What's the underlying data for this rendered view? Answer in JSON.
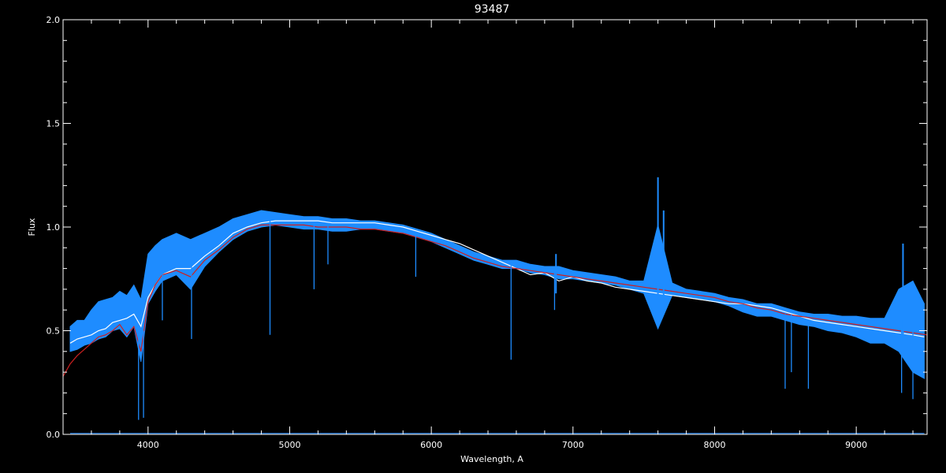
{
  "chart_data": {
    "type": "line",
    "title": "93487",
    "xlabel": "Wavelength, A",
    "ylabel": "Flux",
    "xlim": [
      3400,
      9500
    ],
    "ylim": [
      0.0,
      2.0
    ],
    "xticks": [
      "4000",
      "5000",
      "6000",
      "7000",
      "8000",
      "9000"
    ],
    "yticks": [
      "0.0",
      "0.5",
      "1.0",
      "1.5",
      "2.0"
    ],
    "grid": false,
    "background": "#000000",
    "axis_color": "#ffffff",
    "series": [
      {
        "role": "observed",
        "color": "#ffffff",
        "x": [
          3450,
          3500,
          3550,
          3600,
          3650,
          3700,
          3750,
          3800,
          3850,
          3900,
          3950,
          4000,
          4050,
          4100,
          4200,
          4300,
          4400,
          4500,
          4600,
          4700,
          4800,
          4900,
          5000,
          5100,
          5200,
          5300,
          5400,
          5500,
          5600,
          5700,
          5800,
          5900,
          6000,
          6100,
          6200,
          6300,
          6400,
          6500,
          6600,
          6700,
          6800,
          6900,
          7000,
          7100,
          7200,
          7300,
          7400,
          7500,
          7600,
          7700,
          7800,
          7900,
          8000,
          8100,
          8200,
          8300,
          8400,
          8500,
          8600,
          8700,
          8800,
          8900,
          9000,
          9100,
          9200,
          9300,
          9400,
          9480
        ],
        "y": [
          0.44,
          0.46,
          0.47,
          0.48,
          0.5,
          0.51,
          0.54,
          0.55,
          0.56,
          0.58,
          0.52,
          0.66,
          0.72,
          0.77,
          0.8,
          0.8,
          0.86,
          0.91,
          0.97,
          1.0,
          1.02,
          1.03,
          1.03,
          1.03,
          1.03,
          1.02,
          1.02,
          1.02,
          1.02,
          1.01,
          1.0,
          0.98,
          0.96,
          0.94,
          0.92,
          0.89,
          0.86,
          0.83,
          0.8,
          0.77,
          0.78,
          0.74,
          0.76,
          0.74,
          0.73,
          0.71,
          0.7,
          0.69,
          0.68,
          0.67,
          0.66,
          0.65,
          0.64,
          0.63,
          0.63,
          0.62,
          0.61,
          0.59,
          0.57,
          0.55,
          0.54,
          0.53,
          0.52,
          0.51,
          0.5,
          0.49,
          0.48,
          0.47
        ]
      },
      {
        "role": "observed-error",
        "color": "#1e8cff",
        "x": [
          3450,
          3500,
          3550,
          3600,
          3650,
          3700,
          3750,
          3800,
          3850,
          3900,
          3950,
          4000,
          4050,
          4100,
          4200,
          4300,
          4400,
          4500,
          4600,
          4700,
          4800,
          4900,
          5000,
          5100,
          5200,
          5300,
          5400,
          5500,
          5600,
          5700,
          5800,
          5900,
          6000,
          6100,
          6200,
          6300,
          6400,
          6500,
          6600,
          6700,
          6800,
          6900,
          7000,
          7100,
          7200,
          7300,
          7400,
          7500,
          7600,
          7700,
          7800,
          7900,
          8000,
          8100,
          8200,
          8300,
          8400,
          8500,
          8600,
          8700,
          8800,
          8900,
          9000,
          9100,
          9200,
          9300,
          9400,
          9480
        ],
        "y": [
          0.46,
          0.48,
          0.49,
          0.52,
          0.55,
          0.56,
          0.58,
          0.6,
          0.57,
          0.62,
          0.5,
          0.75,
          0.8,
          0.84,
          0.87,
          0.82,
          0.89,
          0.94,
          0.99,
          1.02,
          1.04,
          1.04,
          1.03,
          1.02,
          1.02,
          1.01,
          1.01,
          1.01,
          1.01,
          1.0,
          0.99,
          0.97,
          0.95,
          0.92,
          0.89,
          0.86,
          0.84,
          0.82,
          0.82,
          0.8,
          0.79,
          0.78,
          0.77,
          0.76,
          0.75,
          0.74,
          0.72,
          0.71,
          0.76,
          0.7,
          0.68,
          0.67,
          0.66,
          0.64,
          0.62,
          0.6,
          0.6,
          0.58,
          0.56,
          0.55,
          0.54,
          0.53,
          0.52,
          0.5,
          0.5,
          0.55,
          0.52,
          0.45
        ],
        "spread": [
          0.06,
          0.07,
          0.06,
          0.08,
          0.09,
          0.09,
          0.08,
          0.09,
          0.1,
          0.1,
          0.15,
          0.12,
          0.11,
          0.1,
          0.1,
          0.12,
          0.08,
          0.06,
          0.05,
          0.04,
          0.04,
          0.03,
          0.03,
          0.03,
          0.03,
          0.03,
          0.03,
          0.02,
          0.02,
          0.02,
          0.02,
          0.02,
          0.02,
          0.02,
          0.02,
          0.02,
          0.02,
          0.02,
          0.02,
          0.02,
          0.02,
          0.03,
          0.02,
          0.02,
          0.02,
          0.02,
          0.02,
          0.03,
          0.25,
          0.03,
          0.02,
          0.02,
          0.02,
          0.02,
          0.03,
          0.03,
          0.03,
          0.03,
          0.03,
          0.03,
          0.04,
          0.04,
          0.05,
          0.06,
          0.06,
          0.15,
          0.22,
          0.18
        ]
      },
      {
        "role": "model",
        "color": "#cc2020",
        "x": [
          3400,
          3450,
          3500,
          3550,
          3600,
          3650,
          3700,
          3750,
          3800,
          3850,
          3900,
          3950,
          4000,
          4050,
          4100,
          4200,
          4300,
          4400,
          4500,
          4600,
          4700,
          4800,
          4900,
          5000,
          5100,
          5200,
          5300,
          5400,
          5500,
          5600,
          5700,
          5800,
          5900,
          6000,
          6100,
          6200,
          6300,
          6400,
          6500,
          6600,
          6700,
          6800,
          6900,
          7000,
          7100,
          7200,
          7300,
          7400,
          7500,
          7600,
          7700,
          7800,
          7900,
          8000,
          8100,
          8200,
          8300,
          8400,
          8500,
          8600,
          8700,
          8800,
          8900,
          9000,
          9100,
          9200,
          9300,
          9400,
          9500
        ],
        "y": [
          0.28,
          0.34,
          0.38,
          0.41,
          0.44,
          0.47,
          0.48,
          0.5,
          0.53,
          0.48,
          0.52,
          0.4,
          0.64,
          0.72,
          0.77,
          0.79,
          0.76,
          0.84,
          0.89,
          0.95,
          0.99,
          1.01,
          1.01,
          1.01,
          1.01,
          1.0,
          1.0,
          1.0,
          0.99,
          0.99,
          0.98,
          0.97,
          0.95,
          0.93,
          0.91,
          0.88,
          0.85,
          0.83,
          0.81,
          0.8,
          0.79,
          0.78,
          0.77,
          0.76,
          0.75,
          0.74,
          0.73,
          0.72,
          0.71,
          0.7,
          0.69,
          0.68,
          0.67,
          0.66,
          0.64,
          0.63,
          0.61,
          0.6,
          0.58,
          0.57,
          0.56,
          0.55,
          0.54,
          0.53,
          0.52,
          0.51,
          0.5,
          0.49,
          0.48
        ]
      },
      {
        "role": "baseline",
        "color": "#1e8cff",
        "x": [
          3450,
          9480
        ],
        "y": [
          0.005,
          0.005
        ]
      }
    ],
    "absorption_lines": [
      {
        "x": 3933,
        "y": 0.07
      },
      {
        "x": 3968,
        "y": 0.08
      },
      {
        "x": 4101,
        "y": 0.55
      },
      {
        "x": 4307,
        "y": 0.46
      },
      {
        "x": 4861,
        "y": 0.48
      },
      {
        "x": 5172,
        "y": 0.7
      },
      {
        "x": 5270,
        "y": 0.82
      },
      {
        "x": 5890,
        "y": 0.76
      },
      {
        "x": 6563,
        "y": 0.36
      },
      {
        "x": 6870,
        "y": 0.6
      },
      {
        "x": 8498,
        "y": 0.22
      },
      {
        "x": 8542,
        "y": 0.3
      },
      {
        "x": 8662,
        "y": 0.22
      },
      {
        "x": 9320,
        "y": 0.2
      },
      {
        "x": 9400,
        "y": 0.17
      }
    ],
    "emission_features": [
      {
        "x": 6880,
        "y": 0.87
      },
      {
        "x": 7600,
        "y": 1.24
      },
      {
        "x": 7640,
        "y": 1.08
      },
      {
        "x": 9330,
        "y": 0.92
      }
    ]
  }
}
